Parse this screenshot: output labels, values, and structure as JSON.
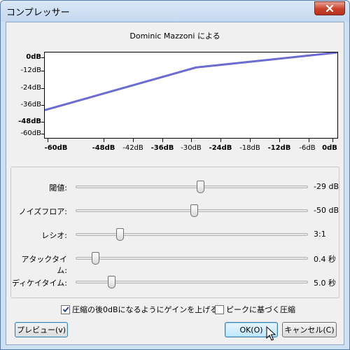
{
  "window": {
    "title": "コンプレッサー",
    "close_icon": "close-icon"
  },
  "plot": {
    "caption": "Dominic Mazzoni による",
    "y_labels": [
      "0dB",
      "-12dB",
      "-24dB",
      "-36dB",
      "-48dB",
      "-60dB"
    ],
    "x_labels": [
      "-60dB",
      "-48dB",
      "-42dB",
      "-36dB",
      "-30dB",
      "-24dB",
      "-18dB",
      "-12dB",
      "-6dB",
      "0dB"
    ],
    "line_color": "#6b6bd0"
  },
  "chart_data": {
    "type": "line",
    "x": [
      -60,
      -29,
      0
    ],
    "y": [
      -40.5,
      -10.5,
      0
    ],
    "xlim": [
      -60,
      0
    ],
    "ylim": [
      -60,
      0
    ],
    "grid": false
  },
  "sliders": [
    {
      "label": "閾値:",
      "value": "-29 dB",
      "position": 0.54
    },
    {
      "label": "ノイズフロア:",
      "value": "-50 dB",
      "position": 0.51
    },
    {
      "label": "レシオ:",
      "value": "3:1",
      "position": 0.18
    },
    {
      "label": "アタックタイム:",
      "value": "0.4 秒",
      "position": 0.07
    },
    {
      "label": "ディケイタイム:",
      "value": "5.0 秒",
      "position": 0.14
    }
  ],
  "checkboxes": {
    "normalize": {
      "label": "圧縮の後0dBになるようにゲインを上げる.",
      "checked": true
    },
    "peak": {
      "label": "ピークに基づく圧縮",
      "checked": false
    }
  },
  "buttons": {
    "preview": "プレビュー(v)",
    "ok": "OK(O)",
    "cancel": "キャンセル(C)"
  }
}
